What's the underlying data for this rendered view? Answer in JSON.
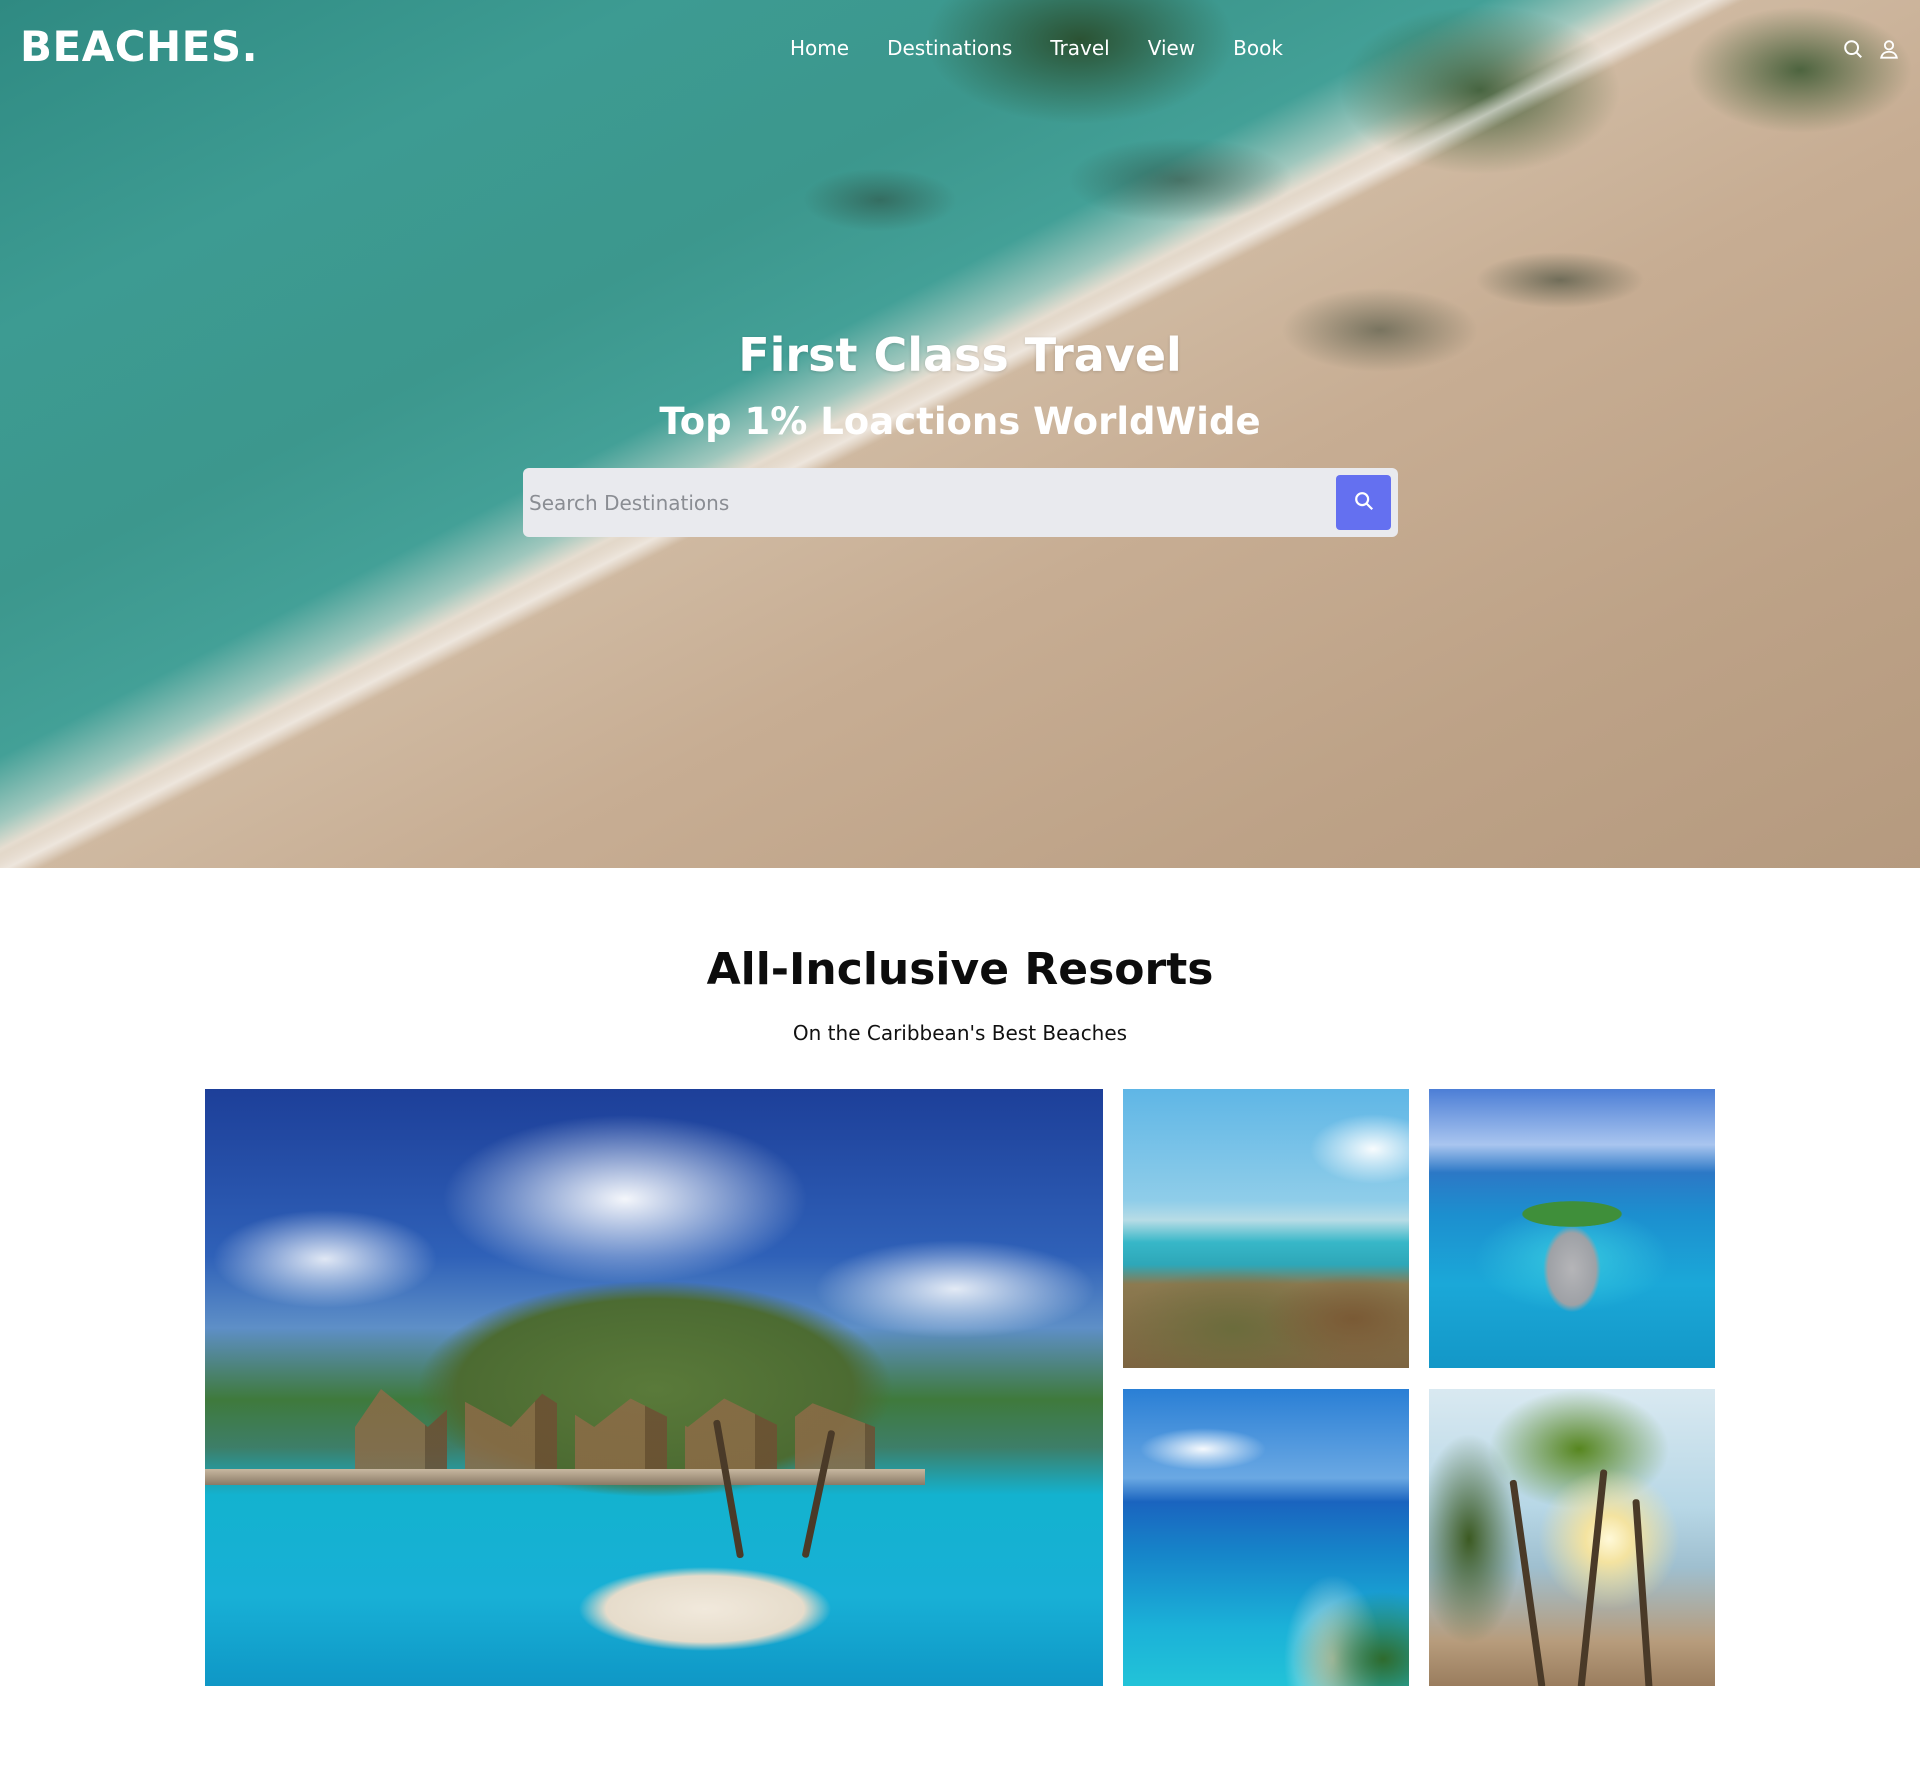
{
  "brand": {
    "logo": "BEACHES."
  },
  "nav": {
    "items": [
      "Home",
      "Destinations",
      "Travel",
      "View",
      "Book"
    ],
    "icons": [
      "search-icon",
      "user-icon"
    ]
  },
  "hero": {
    "title": "First Class Travel",
    "subtitle": "Top 1% Loactions WorldWide",
    "search": {
      "placeholder": "Search Destinations",
      "value": ""
    },
    "colors": {
      "search_button": "#6470f0",
      "search_bg": "#e9eaee"
    }
  },
  "resorts": {
    "title": "All-Inclusive Resorts",
    "subtitle": "On the Caribbean's Best Beaches"
  }
}
